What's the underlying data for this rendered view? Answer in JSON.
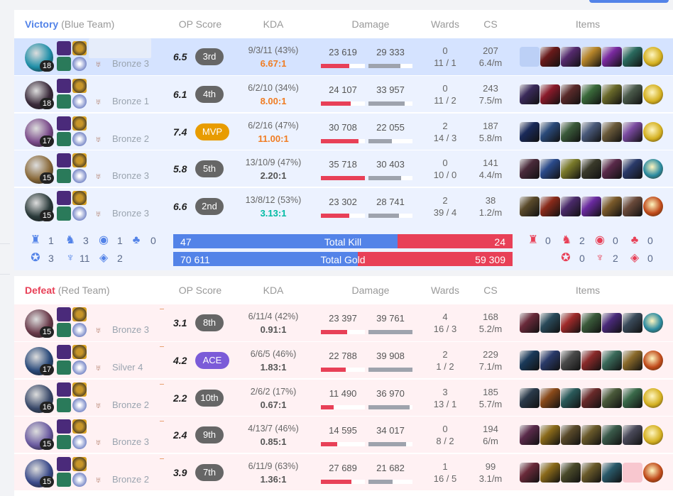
{
  "columns": {
    "op_score": "OP Score",
    "kda": "KDA",
    "damage": "Damage",
    "wards": "Wards",
    "cs": "CS",
    "items": "Items"
  },
  "colors": {
    "blue": "#5383e8",
    "red": "#e84057",
    "mvp": "#e89c00",
    "ace": "#7b5bd8"
  },
  "blue_team": {
    "result": "Victory",
    "label": "(Blue Team)",
    "players": [
      {
        "champion_level": "18",
        "rank": "Bronze 3",
        "op_score": "6.5",
        "op_rank": "3rd",
        "badge": "normal",
        "kda": "9/3/11 (43%)",
        "kda_ratio": "6.67:1",
        "ratio_color": "#f07c22",
        "dealt": "23 619",
        "taken": "29 333",
        "dealt_pct": 0.65,
        "taken_pct": 0.72,
        "wards_placed": "0",
        "wards_line": "11 / 1",
        "cs": "207",
        "cs_per_min": "6.4/m",
        "highlight": true,
        "items": [
          "empty",
          "#6a1a1a",
          "#552a6e",
          "#b8862a",
          "#7a2aa0",
          "#2a6a5e",
          "#d4b020"
        ]
      },
      {
        "champion_level": "18",
        "rank": "Bronze 1",
        "op_score": "6.1",
        "op_rank": "4th",
        "badge": "normal",
        "kda": "6/2/10 (34%)",
        "kda_ratio": "8.00:1",
        "ratio_color": "#f07c22",
        "dealt": "24 107",
        "taken": "33 957",
        "dealt_pct": 0.67,
        "taken_pct": 0.83,
        "wards_placed": "0",
        "wards_line": "11 / 2",
        "cs": "243",
        "cs_per_min": "7.5/m",
        "highlight": false,
        "items": [
          "#3a2a5a",
          "#8a1a2a",
          "#5a2a2a",
          "#3a6a3a",
          "#6a6a2a",
          "#4a5a4a",
          "#d4b020"
        ]
      },
      {
        "champion_level": "17",
        "rank": "Bronze 2",
        "op_score": "7.4",
        "op_rank": "MVP",
        "badge": "mvp",
        "kda": "6/2/16 (47%)",
        "kda_ratio": "11.00:1",
        "ratio_color": "#f07c22",
        "dealt": "30 708",
        "taken": "22 055",
        "dealt_pct": 0.86,
        "taken_pct": 0.54,
        "wards_placed": "2",
        "wards_line": "14 / 3",
        "cs": "187",
        "cs_per_min": "5.8/m",
        "highlight": false,
        "items": [
          "#1a2a5a",
          "#2a4a7a",
          "#3a5a3a",
          "#4a5a7a",
          "#6a5a3a",
          "#7a4aa0",
          "#d4b020"
        ]
      },
      {
        "champion_level": "15",
        "rank": "Bronze 3",
        "op_score": "5.8",
        "op_rank": "5th",
        "badge": "normal",
        "kda": "13/10/9 (47%)",
        "kda_ratio": "2.20:1",
        "ratio_color": "#555555",
        "dealt": "35 718",
        "taken": "30 403",
        "dealt_pct": 1.0,
        "taken_pct": 0.74,
        "wards_placed": "0",
        "wards_line": "10 / 0",
        "cs": "141",
        "cs_per_min": "4.4/m",
        "highlight": false,
        "items": [
          "#4a2a3a",
          "#2a4a8a",
          "#7a7a2a",
          "#3a3a2a",
          "#5a2a4a",
          "#2a3a6a",
          "#2a8aa0"
        ]
      },
      {
        "champion_level": "15",
        "rank": "Bronze 3",
        "op_score": "6.6",
        "op_rank": "2nd",
        "badge": "normal",
        "kda": "13/8/12 (53%)",
        "kda_ratio": "3.13:1",
        "ratio_color": "#00bba3",
        "dealt": "23 302",
        "taken": "28 741",
        "dealt_pct": 0.65,
        "taken_pct": 0.7,
        "wards_placed": "2",
        "wards_line": "39 / 4",
        "cs": "38",
        "cs_per_min": "1.2/m",
        "highlight": false,
        "items": [
          "#5a4a2a",
          "#8a2a1a",
          "#4a2a6a",
          "#6a2aa0",
          "#7a5a2a",
          "#6a4a3a",
          "#c04a1a"
        ]
      }
    ],
    "objectives": {
      "baron": "1",
      "dragon": "3",
      "herald": "1",
      "grub": "0",
      "tower": "3",
      "inhibitor": "11",
      "rift": "2"
    }
  },
  "totals": {
    "kill_label": "Total Kill",
    "blue_kills": "47",
    "red_kills": "24",
    "kill_blue_pct": 0.662,
    "gold_label": "Total Gold",
    "blue_gold": "70 611",
    "red_gold": "59 309",
    "gold_blue_pct": 0.543
  },
  "red_objectives": {
    "baron": "0",
    "dragon": "2",
    "herald": "0",
    "grub": "0",
    "tower": "0",
    "inhibitor": "2",
    "rift": "0"
  },
  "red_team": {
    "result": "Defeat",
    "label": "(Red Team)",
    "players": [
      {
        "champion_level": "15",
        "rank": "Bronze 3",
        "op_score": "3.1",
        "op_rank": "8th",
        "badge": "normal",
        "kda": "6/11/4 (42%)",
        "kda_ratio": "0.91:1",
        "ratio_color": "#555555",
        "dealt": "23 397",
        "taken": "39 761",
        "dealt_pct": 0.59,
        "taken_pct": 1.0,
        "wards_placed": "4",
        "wards_line": "16 / 3",
        "cs": "168",
        "cs_per_min": "5.2/m",
        "highlight": false,
        "items": [
          "#6a2a3a",
          "#2a4a5a",
          "#a02a2a",
          "#3a5a3a",
          "#4a2a7a",
          "#3a4a5a",
          "#2a8aa0"
        ]
      },
      {
        "champion_level": "17",
        "rank": "Silver 4",
        "op_score": "4.2",
        "op_rank": "ACE",
        "badge": "ace",
        "kda": "6/6/5 (46%)",
        "kda_ratio": "1.83:1",
        "ratio_color": "#555555",
        "dealt": "22 788",
        "taken": "39 908",
        "dealt_pct": 0.57,
        "taken_pct": 1.0,
        "wards_placed": "2",
        "wards_line": "1 / 2",
        "cs": "229",
        "cs_per_min": "7.1/m",
        "highlight": false,
        "items": [
          "#1a3a5a",
          "#2a3a6a",
          "#4a4a4a",
          "#8a2a2a",
          "#3a6a5a",
          "#8a6a2a",
          "#c04a1a"
        ]
      },
      {
        "champion_level": "16",
        "rank": "Bronze 2",
        "op_score": "2.2",
        "op_rank": "10th",
        "badge": "normal",
        "kda": "2/6/2 (17%)",
        "kda_ratio": "0.67:1",
        "ratio_color": "#555555",
        "dealt": "11 490",
        "taken": "36 970",
        "dealt_pct": 0.29,
        "taken_pct": 0.93,
        "wards_placed": "3",
        "wards_line": "13 / 1",
        "cs": "185",
        "cs_per_min": "5.7/m",
        "highlight": false,
        "items": [
          "#2a3a4a",
          "#8a4a1a",
          "#2a5a5a",
          "#6a2a2a",
          "#4a5a3a",
          "#3a6a4a",
          "#d4b020"
        ]
      },
      {
        "champion_level": "15",
        "rank": "Bronze 3",
        "op_score": "2.4",
        "op_rank": "9th",
        "badge": "normal",
        "kda": "4/13/7 (46%)",
        "kda_ratio": "0.85:1",
        "ratio_color": "#555555",
        "dealt": "14 595",
        "taken": "34 017",
        "dealt_pct": 0.37,
        "taken_pct": 0.86,
        "wards_placed": "0",
        "wards_line": "8 / 2",
        "cs": "194",
        "cs_per_min": "6/m",
        "highlight": false,
        "items": [
          "#5a2a4a",
          "#8a6a1a",
          "#5a4a2a",
          "#6a5a2a",
          "#3a5a4a",
          "#4a4a5a",
          "#d4b020"
        ]
      },
      {
        "champion_level": "15",
        "rank": "Bronze 2",
        "op_score": "3.9",
        "op_rank": "7th",
        "badge": "normal",
        "kda": "6/11/9 (63%)",
        "kda_ratio": "1.36:1",
        "ratio_color": "#555555",
        "dealt": "27 689",
        "taken": "21 682",
        "dealt_pct": 0.7,
        "taken_pct": 0.55,
        "wards_placed": "1",
        "wards_line": "16 / 5",
        "cs": "99",
        "cs_per_min": "3.1/m",
        "highlight": false,
        "items": [
          "#6a2a3a",
          "#8a6a1a",
          "#4a4a2a",
          "#6a5a2a",
          "#2a5a6a",
          "empty",
          "#c04a1a"
        ]
      }
    ]
  },
  "champion_colors": {
    "blue": [
      "#1f8fa8",
      "#3a2a3a",
      "#7a4a8a",
      "#8a6a3a",
      "#2a3a3a"
    ],
    "red": [
      "#6a3a4a",
      "#2a4a7a",
      "#3a4a6a",
      "#6a5aa0",
      "#3a4a8a"
    ]
  },
  "spell_colors": [
    "#4a2a7a",
    "#d8a020",
    "#2a7a5a",
    "#c86a20"
  ],
  "rune_colors": [
    "#c8962a",
    "#7a8ac8"
  ]
}
